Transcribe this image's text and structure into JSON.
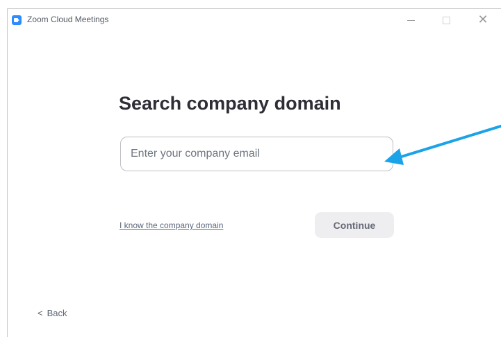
{
  "window": {
    "title": "Zoom Cloud Meetings",
    "icon": "zoom-logo-icon",
    "controls": {
      "minimize_icon": "minimize-icon",
      "maximize_icon": "maximize-icon",
      "close_icon": "close-icon",
      "close_glyph": "✕"
    }
  },
  "main": {
    "heading": "Search company domain",
    "email_field": {
      "placeholder": "Enter your company email",
      "value": ""
    },
    "domain_link": "I know the company domain",
    "continue_label": "Continue",
    "arrow_icon": "annotation-arrow-icon"
  },
  "footer": {
    "back_label": "Back",
    "back_glyph": "<",
    "back_icon": "chevron-left-icon"
  },
  "colors": {
    "accent": "#2d8cff",
    "annotation_arrow": "#1aa3e8",
    "heading": "#2e2e37",
    "continue_bg": "#eeeef1"
  }
}
